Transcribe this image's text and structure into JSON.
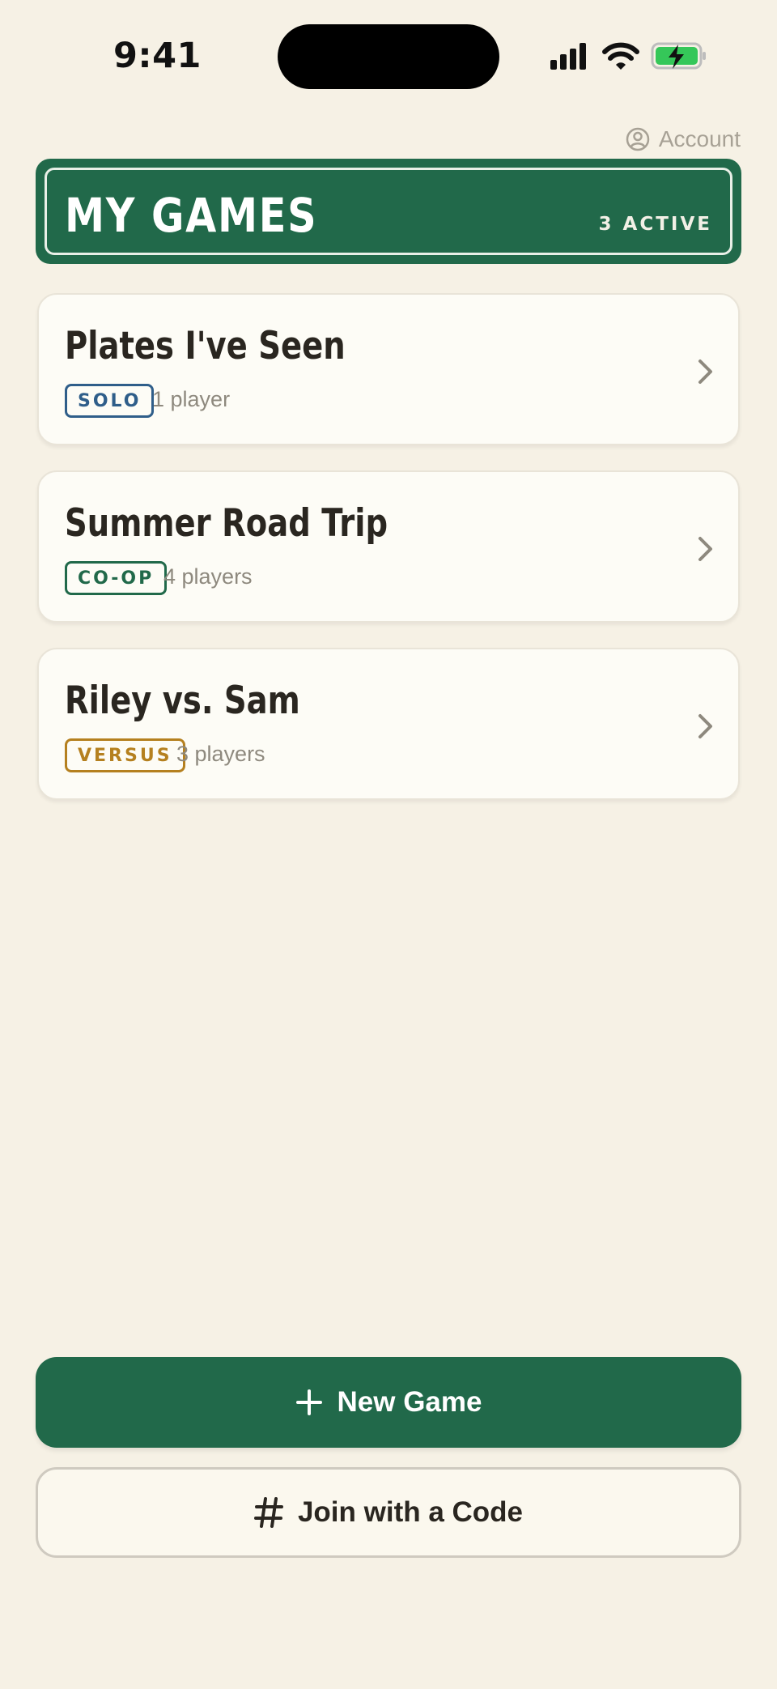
{
  "status_bar": {
    "time": "9:41"
  },
  "account": {
    "label": "Account"
  },
  "header": {
    "title": "MY GAMES",
    "count": "3 ACTIVE"
  },
  "games": [
    {
      "title": "Plates I've Seen",
      "mode": "SOLO",
      "mode_color": "#2F5E8A",
      "players": "1 player"
    },
    {
      "title": "Summer Road Trip",
      "mode": "CO-OP",
      "mode_color": "#21694A",
      "players": "4 players"
    },
    {
      "title": "Riley vs. Sam",
      "mode": "VERSUS",
      "mode_color": "#B5801F",
      "players": "3 players"
    }
  ],
  "actions": {
    "new_game": "New Game",
    "join_code": "Join with a Code"
  },
  "colors": {
    "primary": "#21694A",
    "background": "#F6F1E5"
  },
  "icons": {
    "account": "person-circle-icon",
    "chevron": "chevron-right-icon",
    "new": "plus-icon",
    "join": "hash-icon"
  }
}
